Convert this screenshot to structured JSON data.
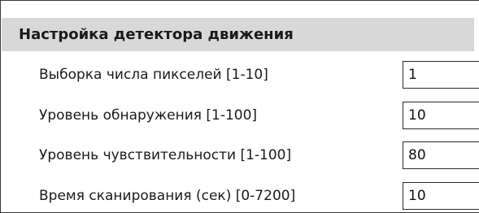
{
  "panel": {
    "title": "Настройка детектора движения",
    "rows": [
      {
        "label": "Выборка числа пикселей [1-10]",
        "value": "1"
      },
      {
        "label": "Уровень обнаружения [1-100]",
        "value": "10"
      },
      {
        "label": "Уровень чувствительности [1-100]",
        "value": "80"
      },
      {
        "label": "Время сканирования (сек) [0-7200]",
        "value": "10"
      }
    ]
  },
  "colors": {
    "header_background": "#d8d8d8",
    "border": "#2b2b2b",
    "text": "#1a1a1a"
  }
}
